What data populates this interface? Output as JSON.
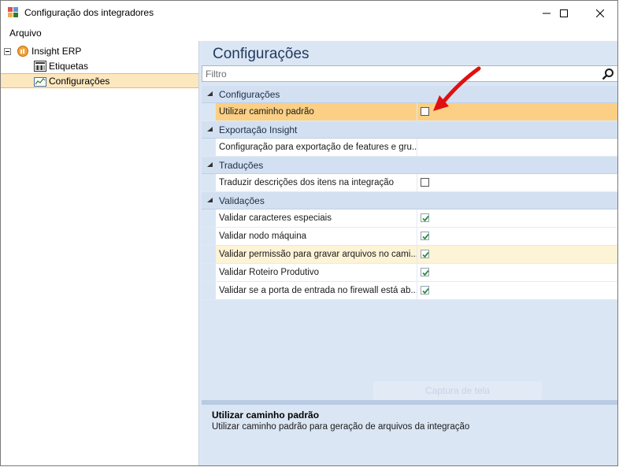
{
  "window": {
    "title": "Configuração dos integradores"
  },
  "menu": {
    "items": [
      "Arquivo"
    ]
  },
  "tree": {
    "root": {
      "label": "Insight ERP"
    },
    "children": [
      {
        "label": "Etiquetas"
      },
      {
        "label": "Configurações",
        "selected": true
      }
    ]
  },
  "main": {
    "title": "Configurações",
    "filter_placeholder": "Filtro",
    "categories": [
      {
        "label": "Configurações",
        "rows": [
          {
            "name": "Utilizar caminho padrão",
            "checked": false
          }
        ]
      },
      {
        "label": "Exportação Insight",
        "rows": [
          {
            "name": "Configuração para exportação de features e gru..."
          }
        ]
      },
      {
        "label": "Traduções",
        "rows": [
          {
            "name": "Traduzir descrições dos itens na integração",
            "checked": false
          }
        ]
      },
      {
        "label": "Validações",
        "rows": [
          {
            "name": "Validar caracteres especiais",
            "checked": true
          },
          {
            "name": "Validar nodo máquina",
            "checked": true
          },
          {
            "name": "Validar permissão para gravar arquivos no cami...",
            "checked": true
          },
          {
            "name": "Validar Roteiro Produtivo",
            "checked": true
          },
          {
            "name": "Validar se a porta de entrada no firewall está ab...",
            "checked": true
          }
        ]
      }
    ],
    "ghost_button": "Captura de tela",
    "description": {
      "title": "Utilizar caminho padrão",
      "text": "Utilizar caminho padrão para geração de arquivos da integração"
    }
  },
  "colors": {
    "selection": "#fbcf84",
    "pane_bg": "#dbe6f4",
    "annotation_arrow": "#e01010"
  }
}
